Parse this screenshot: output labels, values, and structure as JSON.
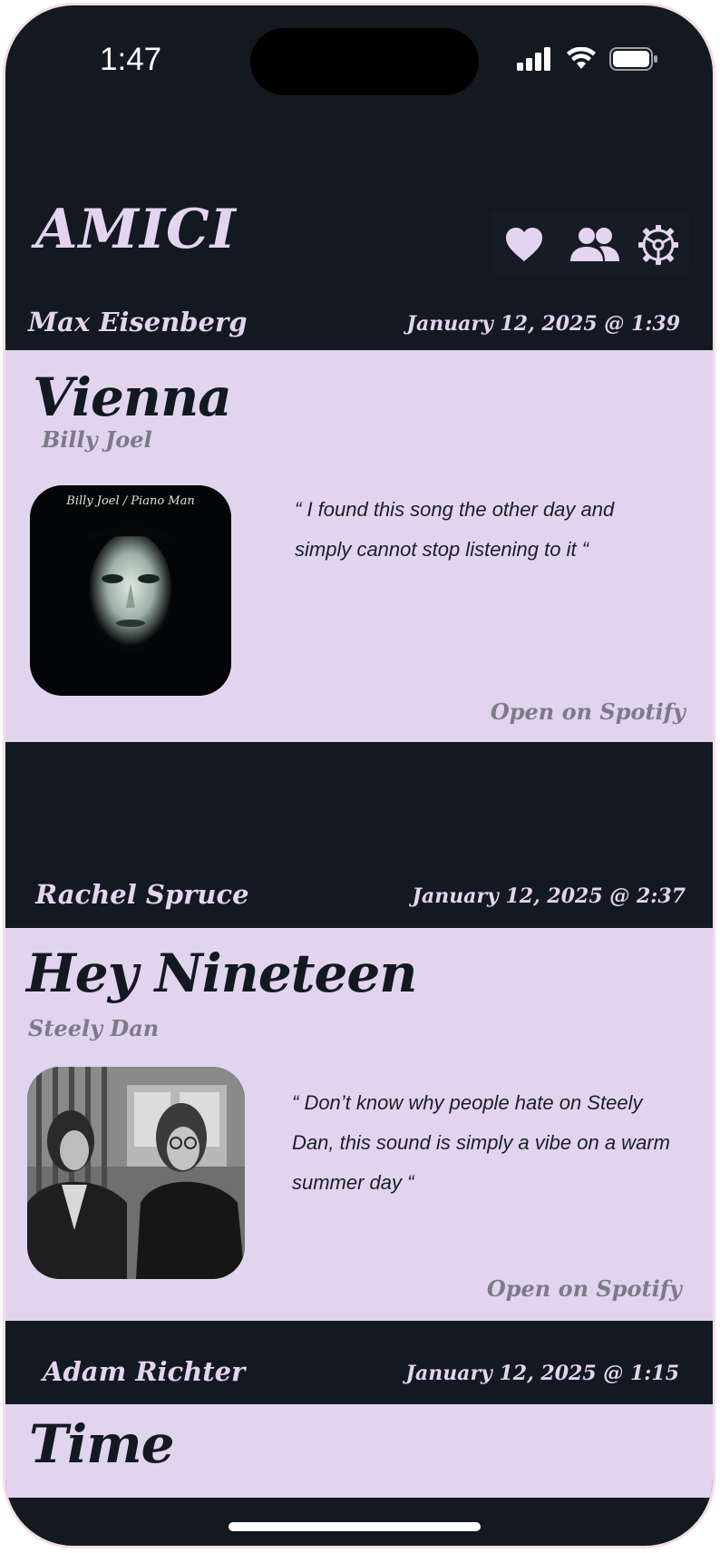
{
  "status_bar": {
    "time": "1:47"
  },
  "header": {
    "app_title": "AMICI",
    "icons": [
      "heart-icon",
      "friends-icon",
      "settings-gear-icon"
    ]
  },
  "colors": {
    "background": "#131920",
    "card": "#e2d4ee",
    "accent_text": "#e4d4ef",
    "muted_text": "#7b7a86"
  },
  "feed": [
    {
      "user": "Max Eisenberg",
      "timestamp": "January 12, 2025 @ 1:39",
      "song_title": "Vienna",
      "artist": "Billy Joel",
      "album_art_text": "Billy Joel / Piano Man",
      "quote": "“ I found this song the other day and simply cannot stop listening to it “",
      "spotify_label": "Open on Spotify"
    },
    {
      "user": "Rachel Spruce",
      "timestamp": "January 12, 2025 @ 2:37",
      "song_title": "Hey Nineteen",
      "artist": "Steely Dan",
      "quote": "“ Don’t know why people hate on Steely Dan, this sound is simply a vibe on a warm summer day “",
      "spotify_label": "Open on Spotify"
    },
    {
      "user": "Adam Richter",
      "timestamp": "January 12, 2025 @ 1:15",
      "song_title": "Time"
    }
  ]
}
